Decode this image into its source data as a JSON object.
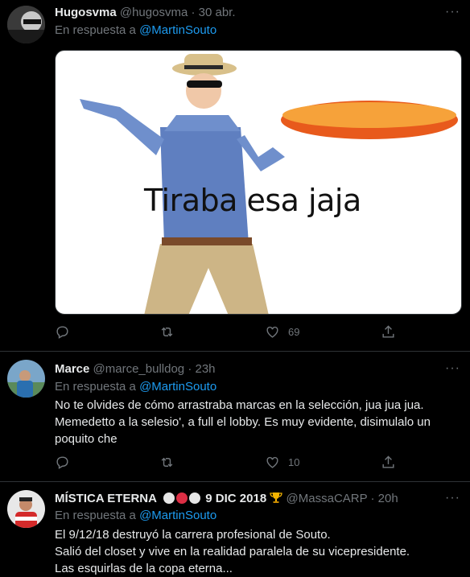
{
  "tweets": [
    {
      "display_name": "Hugosvma",
      "handle": "@hugosvma",
      "time": "· 30 abr.",
      "reply_prefix": "En respuesta a",
      "reply_to": "@MartinSouto",
      "media_caption": "Tiraba esa jaja",
      "reply_count": "",
      "retweet_count": "",
      "like_count": "69"
    },
    {
      "display_name": "Marce",
      "handle": "@marce_bulldog",
      "time": "· 23h",
      "reply_prefix": "En respuesta a",
      "reply_to": "@MartinSouto",
      "text": "No te olvides de cómo arrastraba marcas en la selección, jua jua jua.\nMemedetto a la selesio', a full el lobby. Es muy evidente, disimulalo un\npoquito che",
      "like_count": "10"
    },
    {
      "display_name": "MÍSTICA ETERNA",
      "name_suffix": "9 DIC 2018",
      "handle": "@MassaCARP",
      "time": "· 20h",
      "reply_prefix": "En respuesta a",
      "reply_to": "@MartinSouto",
      "text": "El 9/12/18 destruyó la carrera profesional de Souto.\nSalió del closet y vive en la realidad paralela de su vicepresidente.\nLas esquirlas de la copa eterna..."
    }
  ],
  "more_label": "···",
  "colors": {
    "background": "#000000",
    "link": "#1d9bf0",
    "muted": "#71767b",
    "text": "#e7e9ea"
  }
}
